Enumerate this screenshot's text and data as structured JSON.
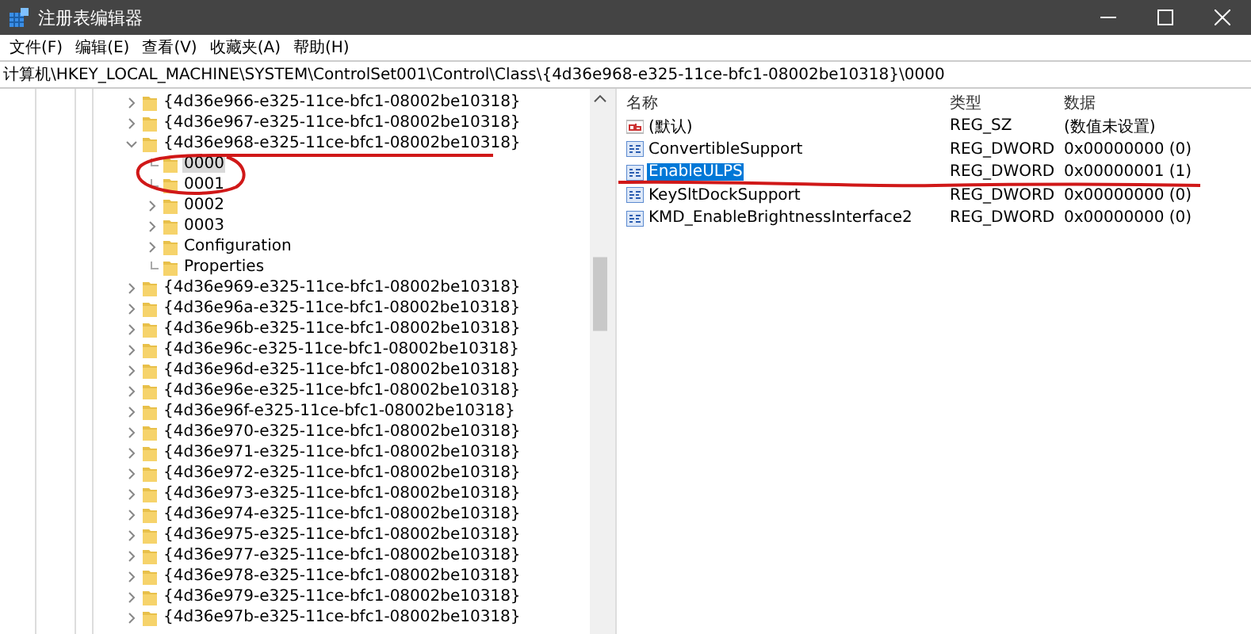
{
  "window": {
    "title": "注册表编辑器"
  },
  "menu": [
    "文件(F)",
    "编辑(E)",
    "查看(V)",
    "收藏夹(A)",
    "帮助(H)"
  ],
  "address": "计算机\\HKEY_LOCAL_MACHINE\\SYSTEM\\ControlSet001\\Control\\Class\\{4d36e968-e325-11ce-bfc1-08002be10318}\\0000",
  "tree": [
    {
      "label": "{4d36e966-e325-11ce-bfc1-08002be10318}",
      "expandable": true,
      "expanded": false,
      "selected": false
    },
    {
      "label": "{4d36e967-e325-11ce-bfc1-08002be10318}",
      "expandable": true,
      "expanded": false,
      "selected": false
    },
    {
      "label": "{4d36e968-e325-11ce-bfc1-08002be10318}",
      "expandable": true,
      "expanded": true,
      "selected": false,
      "children": [
        {
          "label": "0000",
          "expandable": false,
          "selected": true
        },
        {
          "label": "0001",
          "expandable": false,
          "selected": false
        },
        {
          "label": "0002",
          "expandable": true,
          "expanded": false,
          "selected": false
        },
        {
          "label": "0003",
          "expandable": true,
          "expanded": false,
          "selected": false
        },
        {
          "label": "Configuration",
          "expandable": true,
          "expanded": false,
          "selected": false
        },
        {
          "label": "Properties",
          "expandable": false,
          "selected": false
        }
      ]
    },
    {
      "label": "{4d36e969-e325-11ce-bfc1-08002be10318}",
      "expandable": true,
      "expanded": false,
      "selected": false
    },
    {
      "label": "{4d36e96a-e325-11ce-bfc1-08002be10318}",
      "expandable": true,
      "expanded": false,
      "selected": false
    },
    {
      "label": "{4d36e96b-e325-11ce-bfc1-08002be10318}",
      "expandable": true,
      "expanded": false,
      "selected": false
    },
    {
      "label": "{4d36e96c-e325-11ce-bfc1-08002be10318}",
      "expandable": true,
      "expanded": false,
      "selected": false
    },
    {
      "label": "{4d36e96d-e325-11ce-bfc1-08002be10318}",
      "expandable": true,
      "expanded": false,
      "selected": false
    },
    {
      "label": "{4d36e96e-e325-11ce-bfc1-08002be10318}",
      "expandable": true,
      "expanded": false,
      "selected": false
    },
    {
      "label": "{4d36e96f-e325-11ce-bfc1-08002be10318}",
      "expandable": true,
      "expanded": false,
      "selected": false
    },
    {
      "label": "{4d36e970-e325-11ce-bfc1-08002be10318}",
      "expandable": true,
      "expanded": false,
      "selected": false
    },
    {
      "label": "{4d36e971-e325-11ce-bfc1-08002be10318}",
      "expandable": true,
      "expanded": false,
      "selected": false
    },
    {
      "label": "{4d36e972-e325-11ce-bfc1-08002be10318}",
      "expandable": true,
      "expanded": false,
      "selected": false
    },
    {
      "label": "{4d36e973-e325-11ce-bfc1-08002be10318}",
      "expandable": true,
      "expanded": false,
      "selected": false
    },
    {
      "label": "{4d36e974-e325-11ce-bfc1-08002be10318}",
      "expandable": true,
      "expanded": false,
      "selected": false
    },
    {
      "label": "{4d36e975-e325-11ce-bfc1-08002be10318}",
      "expandable": true,
      "expanded": false,
      "selected": false
    },
    {
      "label": "{4d36e977-e325-11ce-bfc1-08002be10318}",
      "expandable": true,
      "expanded": false,
      "selected": false
    },
    {
      "label": "{4d36e978-e325-11ce-bfc1-08002be10318}",
      "expandable": true,
      "expanded": false,
      "selected": false
    },
    {
      "label": "{4d36e979-e325-11ce-bfc1-08002be10318}",
      "expandable": true,
      "expanded": false,
      "selected": false
    },
    {
      "label": "{4d36e97b-e325-11ce-bfc1-08002be10318}",
      "expandable": true,
      "expanded": false,
      "selected": false
    }
  ],
  "values": {
    "columns": [
      "名称",
      "类型",
      "数据"
    ],
    "rows": [
      {
        "kind": "string",
        "name": "(默认)",
        "type": "REG_SZ",
        "data": "(数值未设置)",
        "selected": false
      },
      {
        "kind": "dword",
        "name": "ConvertibleSupport",
        "type": "REG_DWORD",
        "data": "0x00000000 (0)",
        "selected": false
      },
      {
        "kind": "dword",
        "name": "EnableULPS",
        "type": "REG_DWORD",
        "data": "0x00000001 (1)",
        "selected": true
      },
      {
        "kind": "dword",
        "name": "KeySltDockSupport",
        "type": "REG_DWORD",
        "data": "0x00000000 (0)",
        "selected": false
      },
      {
        "kind": "dword",
        "name": "KMD_EnableBrightnessInterface2",
        "type": "REG_DWORD",
        "data": "0x00000000 (0)",
        "selected": false
      }
    ]
  }
}
